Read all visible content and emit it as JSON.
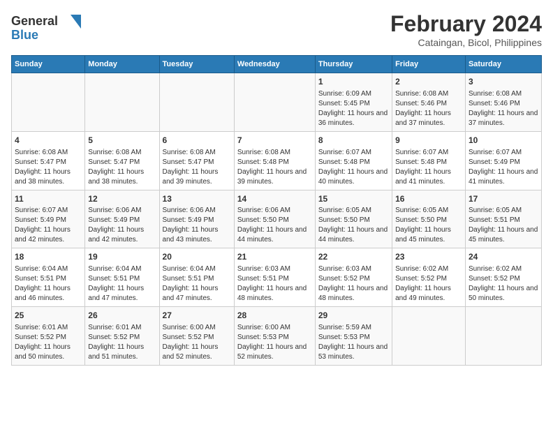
{
  "logo": {
    "line1": "General",
    "line2": "Blue"
  },
  "title": "February 2024",
  "subtitle": "Cataingan, Bicol, Philippines",
  "days_header": [
    "Sunday",
    "Monday",
    "Tuesday",
    "Wednesday",
    "Thursday",
    "Friday",
    "Saturday"
  ],
  "weeks": [
    [
      {
        "day": "",
        "info": ""
      },
      {
        "day": "",
        "info": ""
      },
      {
        "day": "",
        "info": ""
      },
      {
        "day": "",
        "info": ""
      },
      {
        "day": "1",
        "info": "Sunrise: 6:09 AM\nSunset: 5:45 PM\nDaylight: 11 hours and 36 minutes."
      },
      {
        "day": "2",
        "info": "Sunrise: 6:08 AM\nSunset: 5:46 PM\nDaylight: 11 hours and 37 minutes."
      },
      {
        "day": "3",
        "info": "Sunrise: 6:08 AM\nSunset: 5:46 PM\nDaylight: 11 hours and 37 minutes."
      }
    ],
    [
      {
        "day": "4",
        "info": "Sunrise: 6:08 AM\nSunset: 5:47 PM\nDaylight: 11 hours and 38 minutes."
      },
      {
        "day": "5",
        "info": "Sunrise: 6:08 AM\nSunset: 5:47 PM\nDaylight: 11 hours and 38 minutes."
      },
      {
        "day": "6",
        "info": "Sunrise: 6:08 AM\nSunset: 5:47 PM\nDaylight: 11 hours and 39 minutes."
      },
      {
        "day": "7",
        "info": "Sunrise: 6:08 AM\nSunset: 5:48 PM\nDaylight: 11 hours and 39 minutes."
      },
      {
        "day": "8",
        "info": "Sunrise: 6:07 AM\nSunset: 5:48 PM\nDaylight: 11 hours and 40 minutes."
      },
      {
        "day": "9",
        "info": "Sunrise: 6:07 AM\nSunset: 5:48 PM\nDaylight: 11 hours and 41 minutes."
      },
      {
        "day": "10",
        "info": "Sunrise: 6:07 AM\nSunset: 5:49 PM\nDaylight: 11 hours and 41 minutes."
      }
    ],
    [
      {
        "day": "11",
        "info": "Sunrise: 6:07 AM\nSunset: 5:49 PM\nDaylight: 11 hours and 42 minutes."
      },
      {
        "day": "12",
        "info": "Sunrise: 6:06 AM\nSunset: 5:49 PM\nDaylight: 11 hours and 42 minutes."
      },
      {
        "day": "13",
        "info": "Sunrise: 6:06 AM\nSunset: 5:49 PM\nDaylight: 11 hours and 43 minutes."
      },
      {
        "day": "14",
        "info": "Sunrise: 6:06 AM\nSunset: 5:50 PM\nDaylight: 11 hours and 44 minutes."
      },
      {
        "day": "15",
        "info": "Sunrise: 6:05 AM\nSunset: 5:50 PM\nDaylight: 11 hours and 44 minutes."
      },
      {
        "day": "16",
        "info": "Sunrise: 6:05 AM\nSunset: 5:50 PM\nDaylight: 11 hours and 45 minutes."
      },
      {
        "day": "17",
        "info": "Sunrise: 6:05 AM\nSunset: 5:51 PM\nDaylight: 11 hours and 45 minutes."
      }
    ],
    [
      {
        "day": "18",
        "info": "Sunrise: 6:04 AM\nSunset: 5:51 PM\nDaylight: 11 hours and 46 minutes."
      },
      {
        "day": "19",
        "info": "Sunrise: 6:04 AM\nSunset: 5:51 PM\nDaylight: 11 hours and 47 minutes."
      },
      {
        "day": "20",
        "info": "Sunrise: 6:04 AM\nSunset: 5:51 PM\nDaylight: 11 hours and 47 minutes."
      },
      {
        "day": "21",
        "info": "Sunrise: 6:03 AM\nSunset: 5:51 PM\nDaylight: 11 hours and 48 minutes."
      },
      {
        "day": "22",
        "info": "Sunrise: 6:03 AM\nSunset: 5:52 PM\nDaylight: 11 hours and 48 minutes."
      },
      {
        "day": "23",
        "info": "Sunrise: 6:02 AM\nSunset: 5:52 PM\nDaylight: 11 hours and 49 minutes."
      },
      {
        "day": "24",
        "info": "Sunrise: 6:02 AM\nSunset: 5:52 PM\nDaylight: 11 hours and 50 minutes."
      }
    ],
    [
      {
        "day": "25",
        "info": "Sunrise: 6:01 AM\nSunset: 5:52 PM\nDaylight: 11 hours and 50 minutes."
      },
      {
        "day": "26",
        "info": "Sunrise: 6:01 AM\nSunset: 5:52 PM\nDaylight: 11 hours and 51 minutes."
      },
      {
        "day": "27",
        "info": "Sunrise: 6:00 AM\nSunset: 5:52 PM\nDaylight: 11 hours and 52 minutes."
      },
      {
        "day": "28",
        "info": "Sunrise: 6:00 AM\nSunset: 5:53 PM\nDaylight: 11 hours and 52 minutes."
      },
      {
        "day": "29",
        "info": "Sunrise: 5:59 AM\nSunset: 5:53 PM\nDaylight: 11 hours and 53 minutes."
      },
      {
        "day": "",
        "info": ""
      },
      {
        "day": "",
        "info": ""
      }
    ]
  ]
}
